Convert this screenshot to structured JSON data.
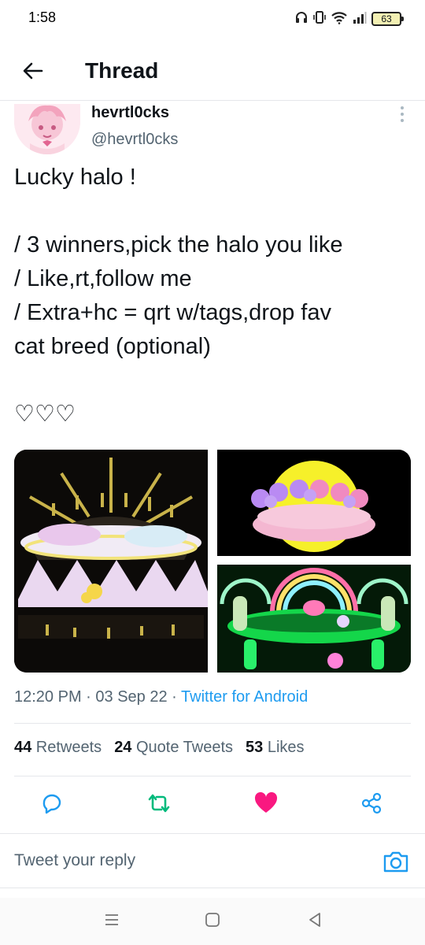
{
  "status_bar": {
    "time": "1:58",
    "battery": "63",
    "icons": [
      "headphones-icon",
      "vibrate-icon",
      "wifi-icon",
      "signal-icon",
      "battery-icon"
    ]
  },
  "app_bar": {
    "title": "Thread",
    "back_icon": "arrow-left-icon"
  },
  "tweet": {
    "author": {
      "name": "hevrtl0cks",
      "handle": "@hevrtl0cks"
    },
    "text_lines": [
      "Lucky halo !",
      "",
      "/ 3 winners,pick the halo you like",
      "/ Like,rt,follow me",
      "/ Extra+hc = qrt w/tags,drop fav",
      "cat breed (optional)",
      "",
      "♡♡♡"
    ],
    "media": [
      "halo-photo",
      "halo-photo",
      "halo-photo"
    ],
    "meta": {
      "time": "12:20 PM",
      "sep1": " · ",
      "date": "03 Sep 22",
      "sep2": " · ",
      "source": "Twitter for Android"
    },
    "stats": {
      "retweets_count": "44",
      "retweets_label": " Retweets",
      "quotes_count": "24",
      "quotes_label": " Quote Tweets",
      "likes_count": "53",
      "likes_label": " Likes"
    },
    "actions": [
      "reply-icon",
      "retweet-icon",
      "like-icon",
      "share-icon"
    ],
    "liked": true,
    "retweeted": true
  },
  "reply": {
    "placeholder": "Tweet your reply",
    "camera_icon": "camera-icon"
  },
  "nav": [
    "menu-icon",
    "home-icon",
    "back-icon"
  ],
  "colors": {
    "accent": "#1d9bf0",
    "retweet_green": "#00ba7c",
    "like_pink": "#f91880",
    "muted_text": "#536471",
    "divider": "#e5e7eb"
  }
}
